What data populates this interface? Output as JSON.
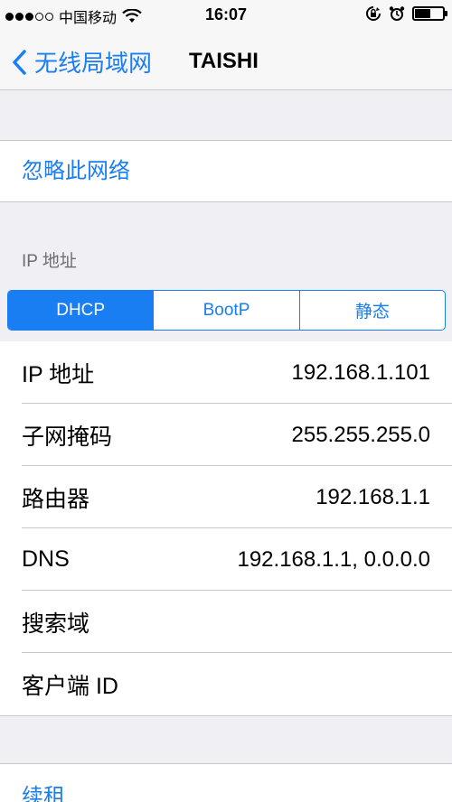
{
  "status_bar": {
    "carrier": "中国移动",
    "time": "16:07",
    "battery_level": 0.55
  },
  "nav": {
    "back_label": "无线局域网",
    "title": "TAISHI"
  },
  "forget_network": "忽略此网络",
  "ip_section_header": "IP 地址",
  "segments": [
    "DHCP",
    "BootP",
    "静态"
  ],
  "selected_segment": "DHCP",
  "rows": [
    {
      "label": "IP 地址",
      "value": "192.168.1.101"
    },
    {
      "label": "子网掩码",
      "value": "255.255.255.0"
    },
    {
      "label": "路由器",
      "value": "192.168.1.1"
    },
    {
      "label": "DNS",
      "value": "192.168.1.1, 0.0.0.0"
    },
    {
      "label": "搜索域",
      "value": ""
    },
    {
      "label": "客户端 ID",
      "value": ""
    }
  ],
  "renew_lease": "续租",
  "colors": {
    "accent": "#1a7ef3",
    "background": "#efeff4",
    "separator": "#c8c7cc"
  }
}
